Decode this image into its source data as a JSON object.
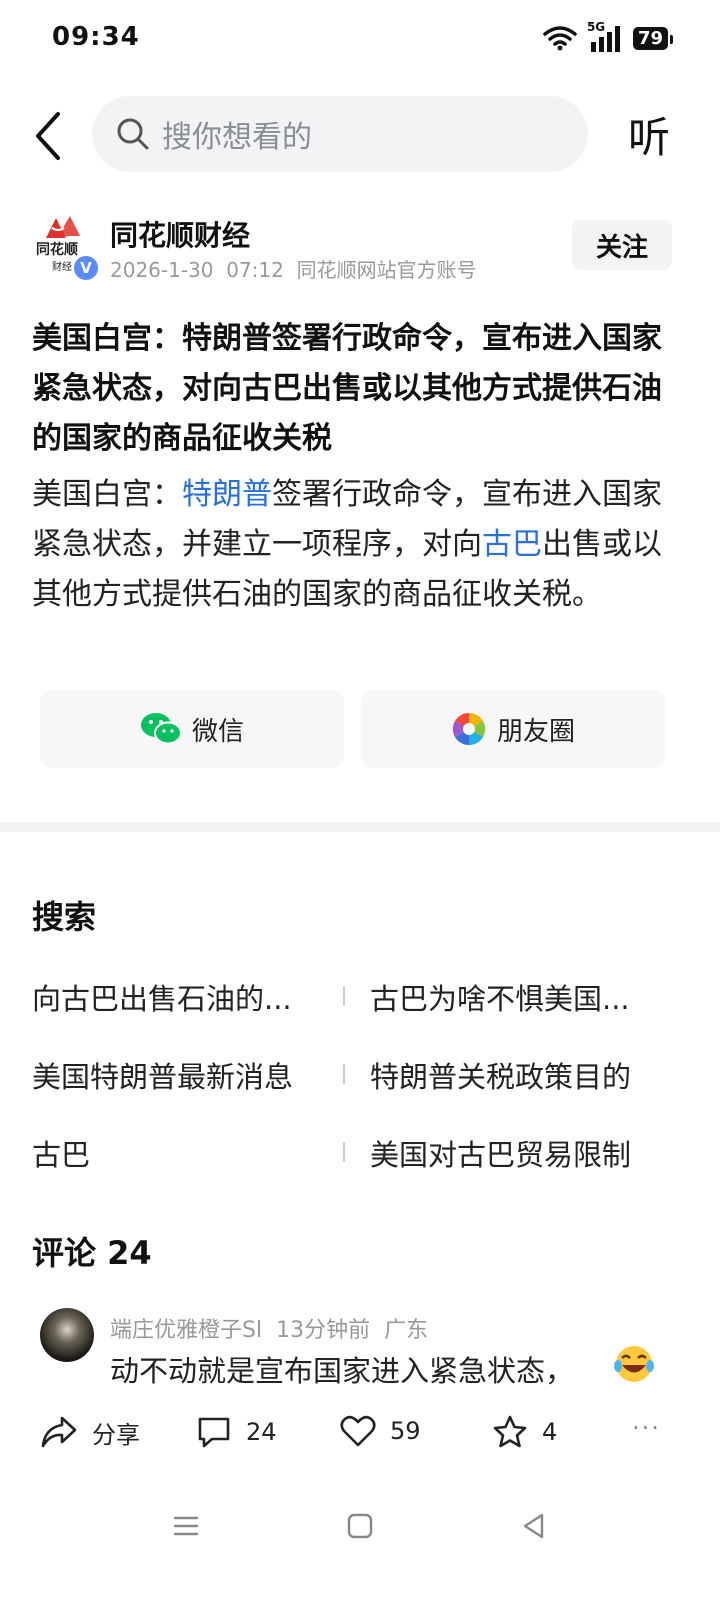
{
  "status_bar": {
    "time": "09:34",
    "network": "5G",
    "battery": "79"
  },
  "header": {
    "search_placeholder": "搜你想看的",
    "listen_label": "听"
  },
  "author": {
    "name": "同花顺财经",
    "logo_text": "同花顺",
    "logo_sub": "财经",
    "date": "2026-1-30",
    "time": "07:12",
    "source": "同花顺网站官方账号",
    "follow_label": "关注"
  },
  "article": {
    "title": "美国白宫：特朗普签署行政命令，宣布进入国家紧急状态，对向古巴出售或以其他方式提供石油的国家的商品征收关税",
    "body_part1": "美国白宫：",
    "body_link1": "特朗普",
    "body_part2": "签署行政命令，宣布进入国家紧急状态，并建立一项程序，对向",
    "body_link2": "古巴",
    "body_part3": "出售或以其他方式提供石油的国家的商品征收关税。"
  },
  "share": {
    "wechat": "微信",
    "moments": "朋友圈"
  },
  "search_section": {
    "title": "搜索",
    "suggestions": [
      [
        "向古巴出售石油的...",
        "古巴为啥不惧美国..."
      ],
      [
        "美国特朗普最新消息",
        "特朗普关税政策目的"
      ],
      [
        "古巴",
        "美国对古巴贸易限制"
      ]
    ]
  },
  "comments": {
    "title": "评论 24",
    "items": [
      {
        "user": "端庄优雅橙子Sl",
        "time": "13分钟前",
        "location": "广东",
        "text": "动不动就是宣布国家进入紧急状态，"
      }
    ]
  },
  "actions": {
    "share": "分享",
    "comments": "24",
    "likes": "59",
    "favorites": "4",
    "more": "···"
  },
  "colors": {
    "link": "#2b6fd8",
    "wechat_green": "#07c160"
  }
}
